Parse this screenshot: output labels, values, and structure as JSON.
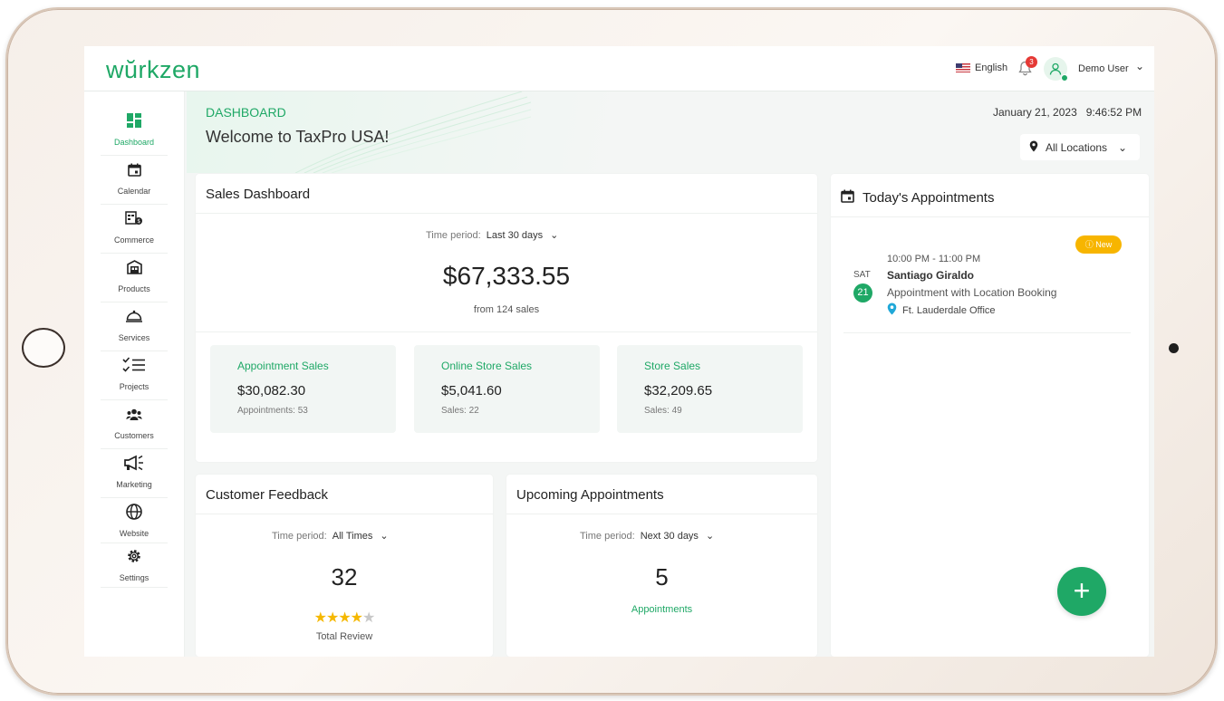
{
  "brand": {
    "logo": "wŭrkzen",
    "accent": "#1fa866"
  },
  "header": {
    "language": "English",
    "notification_count": "3",
    "user_name": "Demo User"
  },
  "sidebar": {
    "items": [
      {
        "label": "Dashboard",
        "icon": "dashboard-icon"
      },
      {
        "label": "Calendar",
        "icon": "calendar-icon"
      },
      {
        "label": "Commerce",
        "icon": "commerce-icon"
      },
      {
        "label": "Products",
        "icon": "products-icon"
      },
      {
        "label": "Services",
        "icon": "services-icon"
      },
      {
        "label": "Projects",
        "icon": "projects-icon"
      },
      {
        "label": "Customers",
        "icon": "customers-icon"
      },
      {
        "label": "Marketing",
        "icon": "marketing-icon"
      },
      {
        "label": "Website",
        "icon": "website-icon"
      },
      {
        "label": "Settings",
        "icon": "settings-icon"
      }
    ]
  },
  "page": {
    "breadcrumb": "DASHBOARD",
    "welcome": "Welcome to TaxPro USA!",
    "datetime": "January 21, 2023   9:46:52 PM",
    "location_filter": "All Locations"
  },
  "sales": {
    "title": "Sales Dashboard",
    "period_label": "Time period:",
    "period_value": "Last 30 days",
    "total": "$67,333.55",
    "total_sub": "from 124 sales",
    "stats": [
      {
        "title": "Appointment Sales",
        "value": "$30,082.30",
        "sub": "Appointments: 53"
      },
      {
        "title": "Online Store Sales",
        "value": "$5,041.60",
        "sub": "Sales: 22"
      },
      {
        "title": "Store Sales",
        "value": "$32,209.65",
        "sub": "Sales: 49"
      }
    ]
  },
  "feedback": {
    "title": "Customer Feedback",
    "period_label": "Time period:",
    "period_value": "All Times",
    "count": "32",
    "rating": 4,
    "caption": "Total Review"
  },
  "upcoming": {
    "title": "Upcoming Appointments",
    "period_label": "Time period:",
    "period_value": "Next 30 days",
    "count": "5",
    "caption": "Appointments"
  },
  "today": {
    "title": "Today's Appointments",
    "appointment": {
      "badge": "New",
      "time": "10:00 PM - 11:00 PM",
      "day": "SAT",
      "date": "21",
      "name": "Santiago Giraldo",
      "description": "Appointment with Location Booking",
      "location": "Ft. Lauderdale Office"
    }
  }
}
